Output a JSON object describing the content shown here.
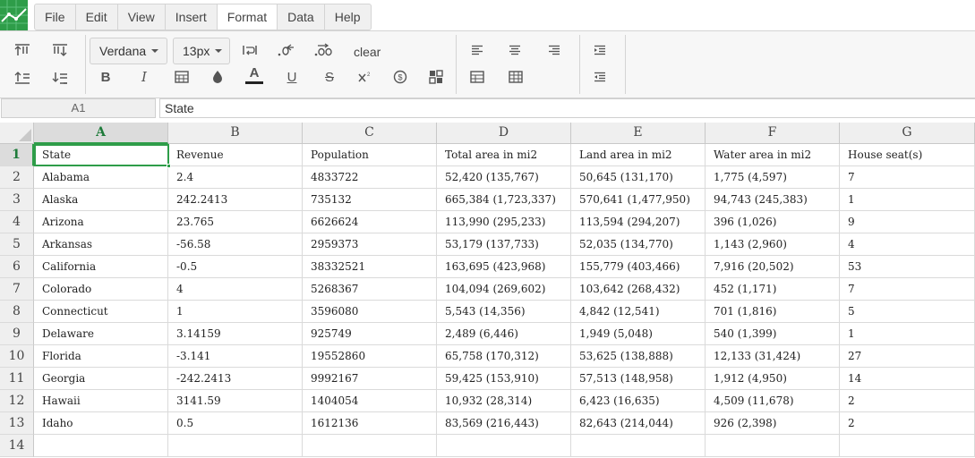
{
  "menu": {
    "tabs": [
      "File",
      "Edit",
      "View",
      "Insert",
      "Format",
      "Data",
      "Help"
    ],
    "active": "Format"
  },
  "toolbar": {
    "font_family": "Verdana",
    "font_size": "13px",
    "clear_label": "clear",
    "icons": {
      "row1": [
        "text-top-align-icon",
        "text-middle-align-icon",
        "dropdown-sep",
        "dropdown-sep",
        "wrap-text-icon",
        "decrease-decimals-icon",
        "increase-decimals-icon",
        "clear",
        "align-left-icon",
        "align-center-icon",
        "align-right-icon",
        "indent-increase-icon"
      ],
      "row2": [
        "text-bottom-align-icon",
        "sort-icon",
        "bold-icon",
        "italic-icon",
        "border-icon",
        "fill-color-icon",
        "text-color-icon",
        "underline-icon",
        "strikethrough-icon",
        "superscript-icon",
        "currency-icon",
        "conditional-format-icon",
        "merge-cells-icon",
        "borders-all-icon",
        "indent-decrease-icon"
      ]
    },
    "text_color_accent": "#222222"
  },
  "formula_bar": {
    "cell_ref": "A1",
    "value": "State"
  },
  "accent_color": "#2e9d49",
  "sheet": {
    "columns": [
      "A",
      "B",
      "C",
      "D",
      "E",
      "F",
      "G"
    ],
    "selected_column": "A",
    "selected_row": "1",
    "row_numbers": [
      "1",
      "2",
      "3",
      "4",
      "5",
      "6",
      "7",
      "8",
      "9",
      "10",
      "11",
      "12",
      "13",
      "14"
    ],
    "rows": [
      [
        "State",
        "Revenue",
        "Population",
        "Total area in mi2",
        "Land area in mi2",
        "Water area in mi2",
        "House seat(s)"
      ],
      [
        "Alabama",
        "2.4",
        "4833722",
        "52,420 (135,767)",
        "50,645 (131,170)",
        "1,775 (4,597)",
        "7"
      ],
      [
        "Alaska",
        "242.2413",
        "735132",
        "665,384 (1,723,337)",
        "570,641 (1,477,950)",
        "94,743 (245,383)",
        "1"
      ],
      [
        "Arizona",
        "23.765",
        "6626624",
        "113,990 (295,233)",
        "113,594 (294,207)",
        "396 (1,026)",
        "9"
      ],
      [
        "Arkansas",
        "-56.58",
        "2959373",
        "53,179 (137,733)",
        "52,035 (134,770)",
        "1,143 (2,960)",
        "4"
      ],
      [
        "California",
        "-0.5",
        "38332521",
        "163,695 (423,968)",
        "155,779 (403,466)",
        "7,916 (20,502)",
        "53"
      ],
      [
        "Colorado",
        "4",
        "5268367",
        "104,094 (269,602)",
        "103,642 (268,432)",
        "452 (1,171)",
        "7"
      ],
      [
        "Connecticut",
        "1",
        "3596080",
        "5,543 (14,356)",
        "4,842 (12,541)",
        "701 (1,816)",
        "5"
      ],
      [
        "Delaware",
        "3.14159",
        "925749",
        "2,489 (6,446)",
        "1,949 (5,048)",
        "540 (1,399)",
        "1"
      ],
      [
        "Florida",
        "-3.141",
        "19552860",
        "65,758 (170,312)",
        "53,625 (138,888)",
        "12,133 (31,424)",
        "27"
      ],
      [
        "Georgia",
        "-242.2413",
        "9992167",
        "59,425 (153,910)",
        "57,513 (148,958)",
        "1,912 (4,950)",
        "14"
      ],
      [
        "Hawaii",
        "3141.59",
        "1404054",
        "10,932 (28,314)",
        "6,423 (16,635)",
        "4,509 (11,678)",
        "2"
      ],
      [
        "Idaho",
        "0.5",
        "1612136",
        "83,569 (216,443)",
        "82,643 (214,044)",
        "926 (2,398)",
        "2"
      ],
      [
        "",
        "",
        "",
        "",
        "",
        "",
        ""
      ]
    ]
  }
}
